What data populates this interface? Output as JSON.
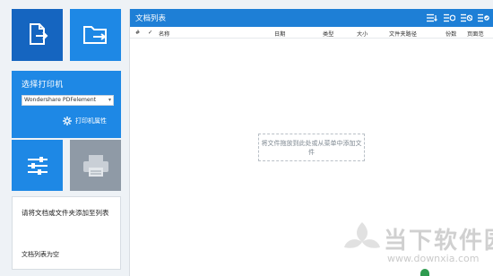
{
  "left": {
    "printer": {
      "label": "选择打印机",
      "selected": "Wondershare PDFelement",
      "properties_label": "打印机属性"
    },
    "info": {
      "message": "请将文档或文件夹添加至列表",
      "status": "文档列表为空"
    }
  },
  "list": {
    "title": "文档列表",
    "columns": {
      "hash": "#",
      "check": "✓",
      "name": "名称",
      "date": "日期",
      "type": "类型",
      "size": "大小",
      "path": "文件夹路径",
      "copies": "份数",
      "pages": "页面范"
    },
    "dropzone_text": "将文件拖放到此处或从菜单中添加文件"
  },
  "watermark": {
    "title": "当下软件园",
    "url": "www.downxia.com"
  },
  "colors": {
    "dark_tile": "#1565c0",
    "blue_tile": "#1e88e5",
    "gray_tile": "#8f9aa6",
    "header": "#1e7fd6"
  }
}
